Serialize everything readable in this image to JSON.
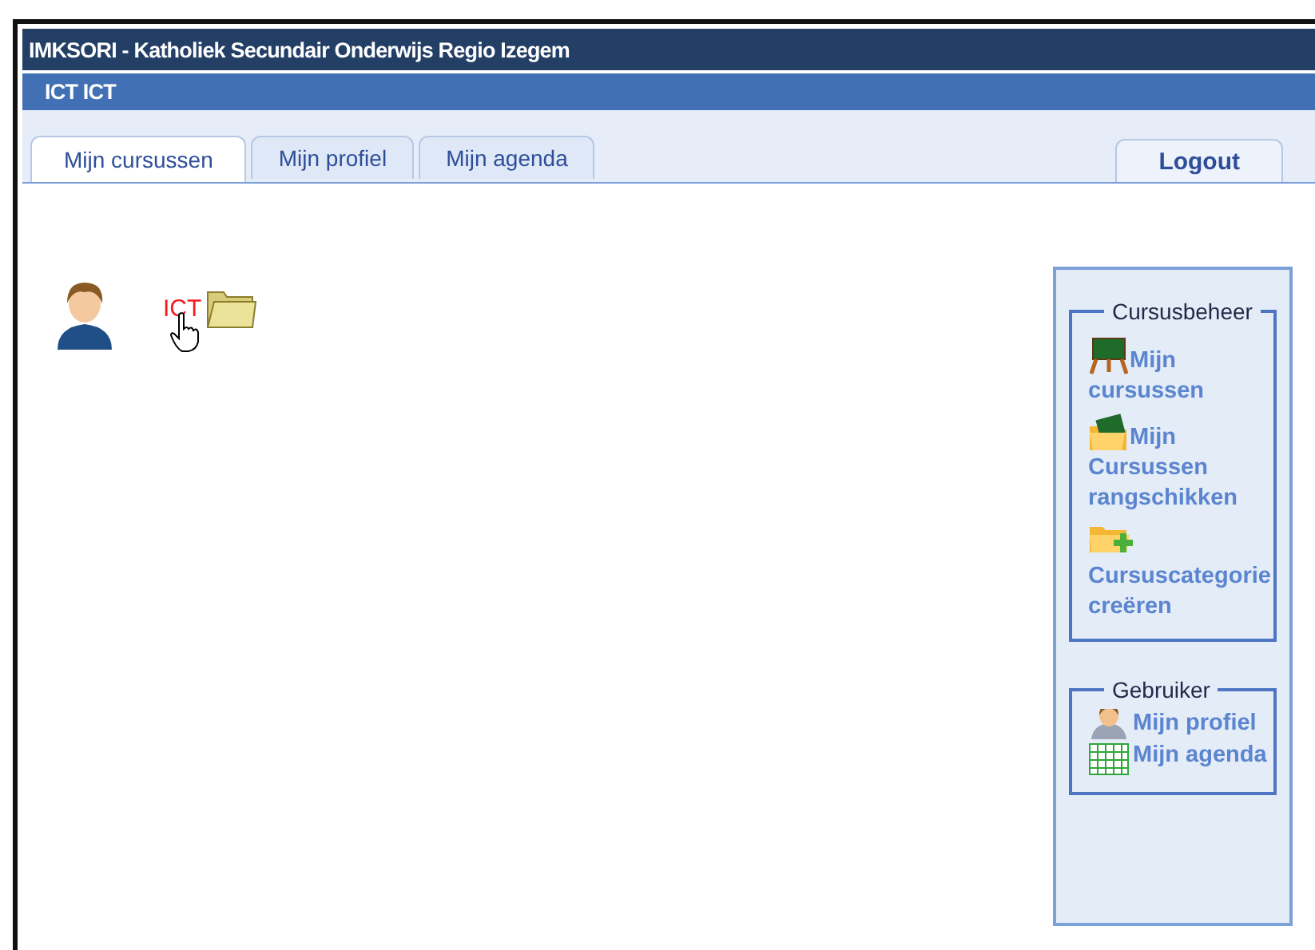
{
  "window": {
    "title": "IMKSORI - Katholiek Secundair Onderwijs Regio Izegem"
  },
  "user_bar": {
    "name": "ICT ICT"
  },
  "tabs": [
    {
      "label": "Mijn cursussen",
      "selected": true
    },
    {
      "label": "Mijn profiel",
      "selected": false
    },
    {
      "label": "Mijn agenda",
      "selected": false
    }
  ],
  "logout": {
    "label": "Logout"
  },
  "courses": [
    {
      "code": "ICT"
    }
  ],
  "sidebar": {
    "sections": [
      {
        "title": "Cursusbeheer",
        "items": [
          {
            "kind": "board",
            "label": "Mijn cursussen"
          },
          {
            "kind": "sort",
            "label": "Mijn Cursussen rangschikken"
          },
          {
            "kind": "addfolder",
            "label": "Cursuscategorie creëren"
          }
        ]
      },
      {
        "title": "Gebruiker",
        "items": [
          {
            "kind": "user",
            "label": "Mijn profiel"
          },
          {
            "kind": "calendar",
            "label": "Mijn agenda"
          }
        ]
      }
    ]
  }
}
